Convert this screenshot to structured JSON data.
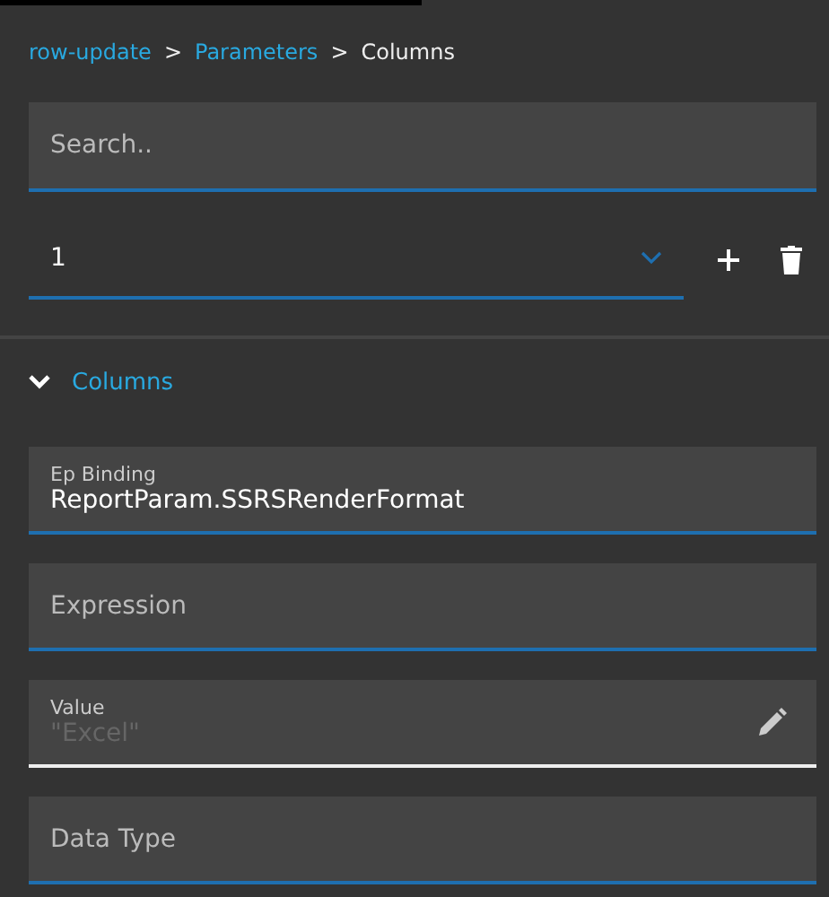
{
  "breadcrumb": [
    {
      "label": "row-update",
      "link": true
    },
    {
      "label": ">",
      "link": false
    },
    {
      "label": "Parameters",
      "link": true
    },
    {
      "label": ">",
      "link": false
    },
    {
      "label": "Columns",
      "link": false
    }
  ],
  "search": {
    "placeholder": "Search.."
  },
  "selector": {
    "value": "1"
  },
  "section": {
    "title": "Columns",
    "expanded": true
  },
  "fields": [
    {
      "kind": "text",
      "label": "Ep Binding",
      "value": "ReportParam.SSRSRenderFormat",
      "disabled": false
    },
    {
      "kind": "text",
      "placeholder": "Expression",
      "disabled": false
    },
    {
      "kind": "readonly",
      "label": "Value",
      "value": "\"Excel\"",
      "disabled": true
    },
    {
      "kind": "text",
      "placeholder": "Data Type",
      "disabled": false
    }
  ]
}
